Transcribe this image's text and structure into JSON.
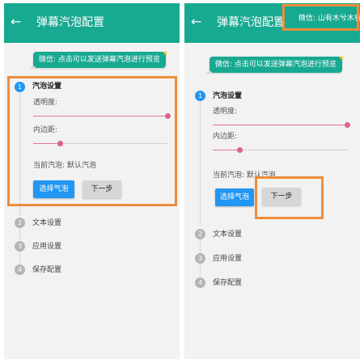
{
  "app": {
    "title": "弹幕汽泡配置",
    "back_icon": "arrow-left-icon"
  },
  "bubble": {
    "text": "微信: 点击可以发送弹幕汽泡进行预览"
  },
  "top_bubble": {
    "text": "微信: 山有木兮木有枝"
  },
  "steps": [
    {
      "number": "1",
      "label": "汽泡设置"
    },
    {
      "number": "2",
      "label": "文本设置"
    },
    {
      "number": "3",
      "label": "应用设置"
    },
    {
      "number": "4",
      "label": "保存配置"
    }
  ],
  "settings": {
    "opacity_label": "透明度:",
    "padding_label": "内边距:",
    "opacity_value": 1.0,
    "padding_value": 0.2,
    "current_bubble": "当前汽泡: 默认汽泡"
  },
  "buttons": {
    "select": "选择气泡",
    "next": "下一步"
  },
  "colors": {
    "appbar": "#18a991",
    "primary": "#2196f3",
    "slider": "#e0608a",
    "highlight": "#ef8c3a"
  }
}
